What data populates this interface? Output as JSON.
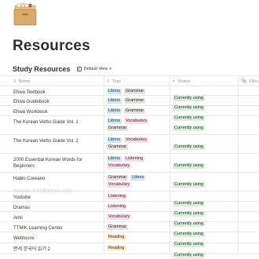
{
  "page": {
    "icon": "file-cabinet-icon",
    "title": "Resources"
  },
  "database": {
    "title": "Study Resources",
    "view_label": "Default View",
    "view_icon": "table-view-icon"
  },
  "columns": [
    {
      "key": "name",
      "label": "Name",
      "icon": "text-icon"
    },
    {
      "key": "tags",
      "label": "Tags",
      "icon": "list-icon"
    },
    {
      "key": "status",
      "label": "Status",
      "icon": "status-icon"
    },
    {
      "key": "files",
      "label": "Files",
      "icon": "attachment-icon"
    }
  ],
  "tag_colors": {
    "Libros": "#d3e5ef",
    "Grammar": "#e3e2e0",
    "Vocabulary": "#f5e0e9",
    "Listening": "#f5e0e9",
    "Reading": "#fdecc8"
  },
  "status_color": "#dbeddb",
  "rows": [
    {
      "name": "Ehwa Textbook",
      "tags": [
        "Libros",
        "Grammar"
      ],
      "status": "Currently using"
    },
    {
      "name": "Ehwa Guidebook",
      "tags": [
        "Libros",
        "Grammar"
      ],
      "status": "Currently using"
    },
    {
      "name": "Ehwa Workbook",
      "tags": [
        "Libros",
        "Grammar"
      ],
      "status": "Currently using"
    },
    {
      "name": "The Korean Verbs Guide Vol. 1",
      "tags": [
        "Libros",
        "Vocabulary",
        "Grammar"
      ],
      "status": "Currently using"
    },
    {
      "name": "The Korean Verbs Guide Vol. 2",
      "tags": [
        "Libros",
        "Vocabulary",
        "Grammar"
      ],
      "status": "Currently using"
    },
    {
      "name": "2000 Essential Korean Words for Beginners",
      "tags": [
        "Libros",
        "Listening",
        "Vocabulary"
      ],
      "status": "Currently using"
    },
    {
      "name": "Hablo Coreano",
      "tags": [
        "Grammar",
        "Libros",
        "Vocabulary"
      ],
      "status": "Currently using"
    },
    {
      "name": "Youtube",
      "tags": [
        "Listening"
      ],
      "status": "Currently using"
    },
    {
      "name": "Dramas",
      "tags": [
        "Listening"
      ],
      "status": "Currently using"
    },
    {
      "name": "Anki",
      "tags": [
        "Vocabulary"
      ],
      "status": "Currently using"
    },
    {
      "name": "TTMIK Learning Center",
      "tags": [
        "Grammar"
      ],
      "status": "Currently using"
    },
    {
      "name": "Webtoons",
      "tags": [
        "Reading"
      ],
      "status": "Currently using"
    },
    {
      "name": "면세 한국어 읽기 2",
      "tags": [
        "Reading"
      ],
      "status": "Currently using"
    }
  ],
  "watermark": "mayas.wordpress.com"
}
